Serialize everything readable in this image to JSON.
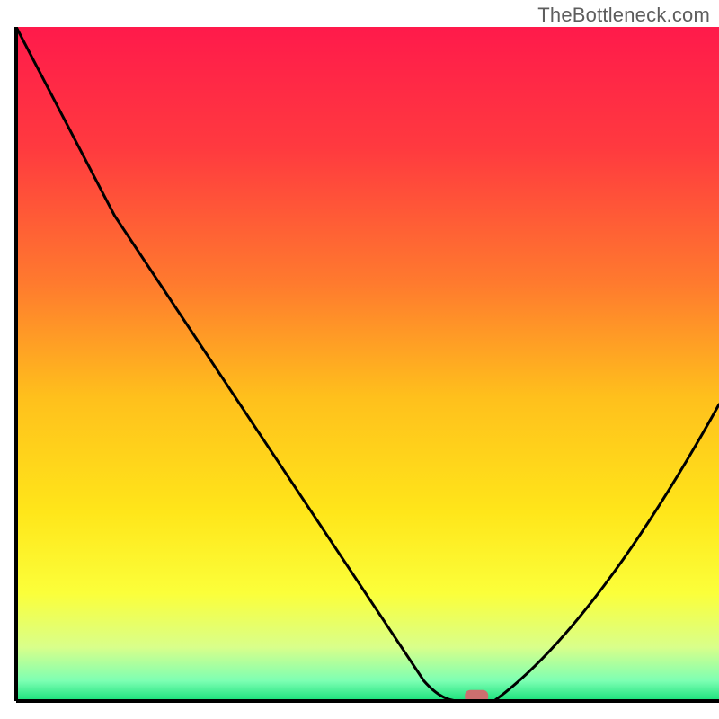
{
  "watermark": "TheBottleneck.com",
  "chart_data": {
    "type": "line",
    "title": "",
    "xlabel": "",
    "ylabel": "",
    "xlim": [
      0,
      100
    ],
    "ylim": [
      0,
      100
    ],
    "gradient_stops": [
      {
        "offset": 0,
        "color": "#ff1a4b"
      },
      {
        "offset": 18,
        "color": "#ff3a3f"
      },
      {
        "offset": 38,
        "color": "#ff7a2e"
      },
      {
        "offset": 55,
        "color": "#ffc01c"
      },
      {
        "offset": 72,
        "color": "#ffe61a"
      },
      {
        "offset": 84,
        "color": "#fbff3a"
      },
      {
        "offset": 92,
        "color": "#d9ff8a"
      },
      {
        "offset": 97,
        "color": "#7dffb3"
      },
      {
        "offset": 100,
        "color": "#18e07a"
      }
    ],
    "curve": {
      "x": [
        0,
        14,
        58,
        63,
        68,
        100
      ],
      "y": [
        100,
        72,
        3,
        0,
        0,
        44
      ],
      "note": "y is distance above baseline as % of plot height; values estimated from pixels"
    },
    "baseline_y": 0,
    "marker": {
      "x": 65.5,
      "y": 0.7,
      "color": "#cc6f6f",
      "shape": "rounded-rect"
    },
    "frame": {
      "left": true,
      "bottom": true,
      "top": false,
      "right": false
    }
  }
}
